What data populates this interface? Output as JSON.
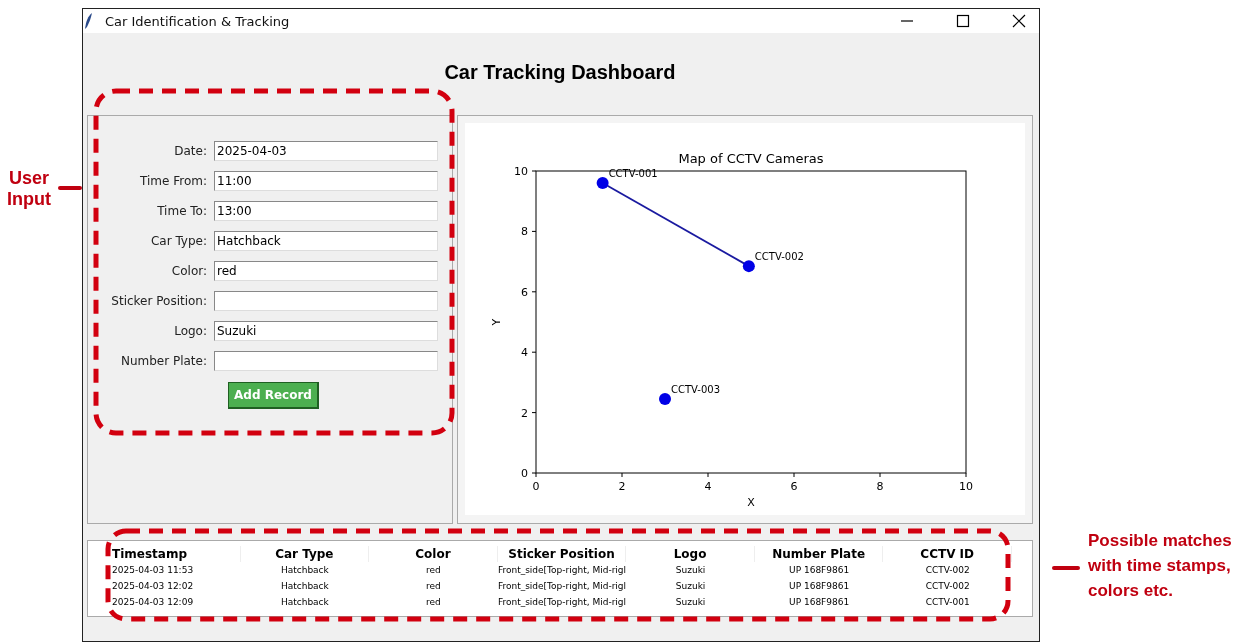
{
  "annotations": [
    {
      "kind": "left",
      "text": "User Input"
    },
    {
      "kind": "right",
      "text": "Possible matches with time stamps, colors etc."
    }
  ],
  "window": {
    "title": "Car Identification & Tracking"
  },
  "heading": "Car Tracking Dashboard",
  "form": {
    "fields": [
      {
        "label": "Date:",
        "value": "2025-04-03"
      },
      {
        "label": "Time From:",
        "value": "11:00"
      },
      {
        "label": "Time To:",
        "value": "13:00"
      },
      {
        "label": "Car Type:",
        "value": "Hatchback"
      },
      {
        "label": "Color:",
        "value": "red"
      },
      {
        "label": "Sticker Position:"
      },
      {
        "label": "Logo:",
        "value": "Suzuki"
      },
      {
        "label": "Number Plate:"
      }
    ],
    "button": "Add Record"
  },
  "chart": {
    "chart_data": {
      "type": "scatter",
      "title": "Map of CCTV Cameras",
      "xlabel": "X",
      "ylabel": "Y",
      "x": [
        1.55,
        4.95,
        3.0
      ],
      "series": [
        {
          "type": "line",
          "color": "#1a1aa0",
          "values": [
            9.6,
            6.85,
            null
          ]
        },
        {
          "color": "#0000e6",
          "values": [
            9.6,
            6.85,
            2.45
          ]
        }
      ],
      "xlim": [
        0,
        10
      ],
      "ylim": [
        0,
        10
      ],
      "xticks": [
        0,
        2,
        4,
        6,
        8,
        10
      ],
      "yticks": [
        0,
        2,
        4,
        6,
        8,
        10
      ],
      "annotations": [
        {
          "text": "CCTV-001",
          "x": 1.55,
          "y": 9.6
        },
        {
          "text": "CCTV-002",
          "x": 4.95,
          "y": 6.85
        },
        {
          "text": "CCTV-003",
          "x": 3.0,
          "y": 2.45
        }
      ]
    }
  },
  "table": {
    "columns": [
      "Timestamp",
      "Car Type",
      "Color",
      "Sticker Position",
      "Logo",
      "Number Plate",
      "CCTV ID"
    ],
    "rows": [
      [
        "2025-04-03 11:53",
        "Hatchback",
        "red",
        "Front_side[Top-right, Mid-rigl",
        "Suzuki",
        "UP 168F9861",
        "CCTV-002"
      ],
      [
        "2025-04-03 12:02",
        "Hatchback",
        "red",
        "Front_side[Top-right, Mid-rigl",
        "Suzuki",
        "UP 168F9861",
        "CCTV-002"
      ],
      [
        "2025-04-03 12:09",
        "Hatchback",
        "red",
        "Front_side[Top-right, Mid-rigl",
        "Suzuki",
        "UP 168F9861",
        "CCTV-001"
      ]
    ]
  }
}
